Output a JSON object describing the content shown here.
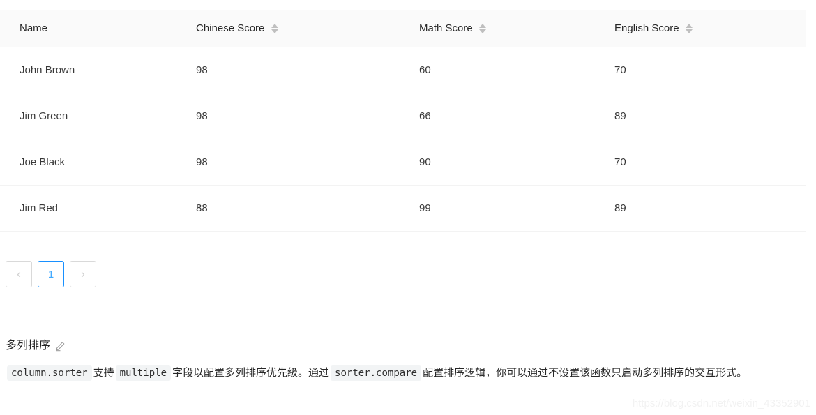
{
  "table": {
    "columns": [
      {
        "label": "Name",
        "sortable": false,
        "sorter_icon": "sort-icon"
      },
      {
        "label": "Chinese Score",
        "sortable": true,
        "sorter_icon": "sort-icon"
      },
      {
        "label": "Math Score",
        "sortable": true,
        "sorter_icon": "sort-icon"
      },
      {
        "label": "English Score",
        "sortable": true,
        "sorter_icon": "sort-icon"
      }
    ],
    "rows": [
      {
        "name": "John Brown",
        "chinese": "98",
        "math": "60",
        "english": "70"
      },
      {
        "name": "Jim Green",
        "chinese": "98",
        "math": "66",
        "english": "89"
      },
      {
        "name": "Joe Black",
        "chinese": "98",
        "math": "90",
        "english": "70"
      },
      {
        "name": "Jim Red",
        "chinese": "88",
        "math": "99",
        "english": "89"
      }
    ]
  },
  "pagination": {
    "prev_label": "‹",
    "prev_icon": "chevron-left-icon",
    "next_label": "›",
    "next_icon": "chevron-right-icon",
    "pages": [
      "1"
    ],
    "current_page": "1",
    "active_color": "#1890ff",
    "active_text_color": "#40a9ff"
  },
  "section": {
    "title": "多列排序",
    "edit_icon": "pencil-icon",
    "desc_parts": [
      {
        "type": "code",
        "text": "column.sorter"
      },
      {
        "type": "text",
        "text": "支持"
      },
      {
        "type": "code",
        "text": "multiple"
      },
      {
        "type": "text",
        "text": "字段以配置多列排序优先级。通过"
      },
      {
        "type": "code",
        "text": "sorter.compare"
      },
      {
        "type": "text",
        "text": "配置排序逻辑，你可以通过不设置该函数只启动多列排序的交互形式。"
      }
    ]
  },
  "watermark": {
    "text": "https://blog.csdn.net/weixin_43352901"
  }
}
